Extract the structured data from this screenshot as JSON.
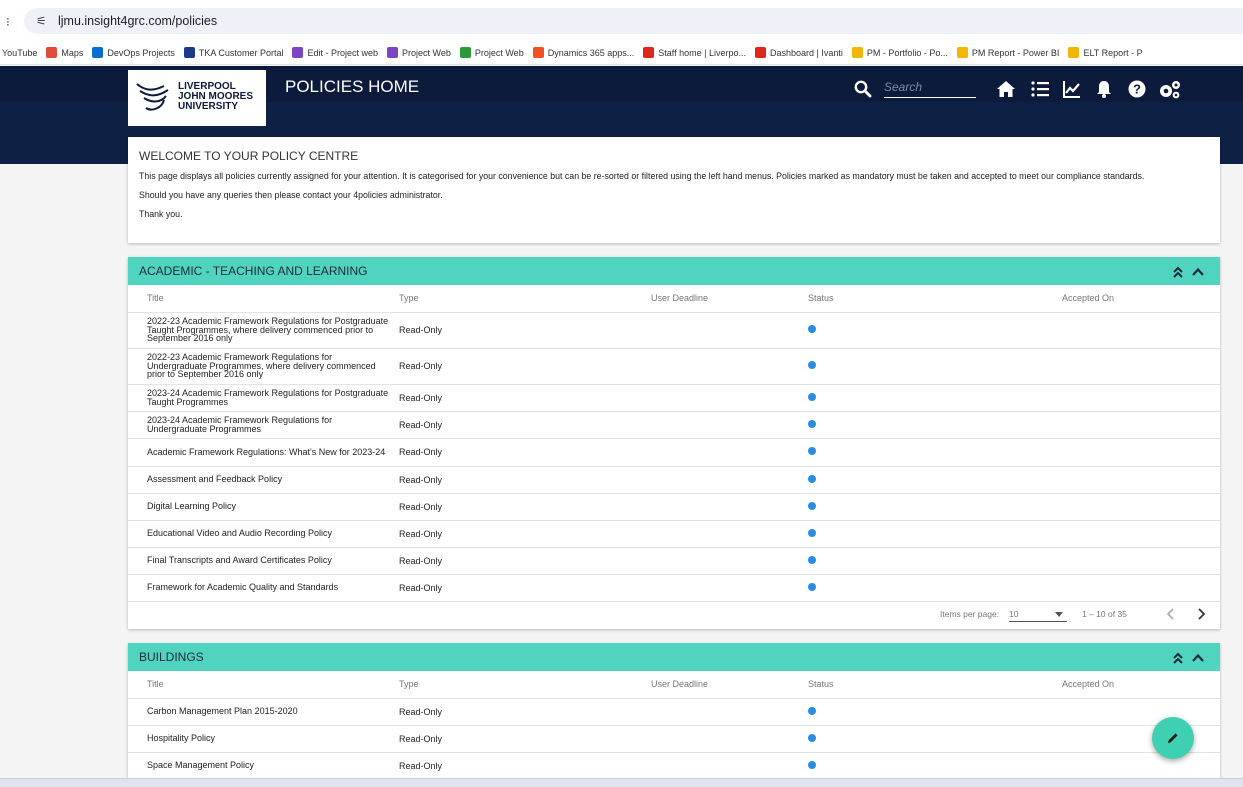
{
  "browser": {
    "url": "ljmu.insight4grc.com/policies",
    "bookmarks": [
      {
        "label": "YouTube",
        "color": ""
      },
      {
        "label": "Maps",
        "color": "#e24a3b"
      },
      {
        "label": "DevOps Projects",
        "color": "#0a6ed1"
      },
      {
        "label": "TKA Customer Portal",
        "color": "#1d3a8a"
      },
      {
        "label": "Edit - Project web",
        "color": "#7b45c4"
      },
      {
        "label": "Project Web",
        "color": "#7b45c4"
      },
      {
        "label": "Project Web",
        "color": "#2b9b3a"
      },
      {
        "label": "Dynamics 365 apps...",
        "color": "#f25022"
      },
      {
        "label": "Staff home | Liverpo...",
        "color": "#e1251b"
      },
      {
        "label": "Dashboard | Ivanti",
        "color": "#e1251b"
      },
      {
        "label": "PM - Portfolio - Po...",
        "color": "#f2b705"
      },
      {
        "label": "PM Report - Power BI",
        "color": "#f2b705"
      },
      {
        "label": "ELT Report - P",
        "color": "#f2b705"
      }
    ]
  },
  "header": {
    "logo_lines": [
      "LIVERPOOL",
      "JOHN MOORES",
      "UNIVERSITY"
    ],
    "title": "POLICIES HOME",
    "search_placeholder": "Search"
  },
  "welcome": {
    "heading": "WELCOME TO YOUR POLICY CENTRE",
    "paragraph1": "This page displays all policies currently assigned for your attention. It is categorised for your convenience but can be re-sorted or filtered using the left hand menus. Policies marked as mandatory must be taken and accepted to meet our compliance standards.",
    "paragraph2": "Should you have any queries then please contact your 4policies administrator.",
    "paragraph3": "Thank you."
  },
  "columns": [
    "Title",
    "Type",
    "User Deadline",
    "Status",
    "Accepted On"
  ],
  "colors": {
    "accent": "#50d4c0",
    "navy": "#0c1a3c",
    "status_dot": "#2b8ce6",
    "fab": "#3fcfb3"
  },
  "sections": [
    {
      "title": "ACADEMIC - TEACHING AND LEARNING",
      "rows": [
        {
          "title": "2022-23 Academic Framework Regulations for Postgraduate Taught Programmes, where delivery commenced prior to September 2016 only",
          "type": "Read-Only",
          "deadline": "",
          "accepted": ""
        },
        {
          "title": "2022-23 Academic Framework Regulations for Undergraduate Programmes, where delivery commenced prior to September 2016 only",
          "type": "Read-Only",
          "deadline": "",
          "accepted": ""
        },
        {
          "title": "2023-24 Academic Framework Regulations for Postgraduate Taught Programmes",
          "type": "Read-Only",
          "deadline": "",
          "accepted": ""
        },
        {
          "title": "2023-24 Academic Framework Regulations for Undergraduate Programmes",
          "type": "Read-Only",
          "deadline": "",
          "accepted": ""
        },
        {
          "title": "Academic Framework Regulations: What's New for 2023-24",
          "type": "Read-Only",
          "deadline": "",
          "accepted": ""
        },
        {
          "title": "Assessment and Feedback Policy",
          "type": "Read-Only",
          "deadline": "",
          "accepted": ""
        },
        {
          "title": "Digital Learning Policy",
          "type": "Read-Only",
          "deadline": "",
          "accepted": ""
        },
        {
          "title": "Educational Video and Audio Recording Policy",
          "type": "Read-Only",
          "deadline": "",
          "accepted": ""
        },
        {
          "title": "Final Transcripts and Award Certificates Policy",
          "type": "Read-Only",
          "deadline": "",
          "accepted": ""
        },
        {
          "title": "Framework for Academic Quality and Standards",
          "type": "Read-Only",
          "deadline": "",
          "accepted": ""
        }
      ],
      "pager": {
        "label": "Items per page:",
        "per_page": "10",
        "range": "1 – 10 of 35"
      }
    },
    {
      "title": "BUILDINGS",
      "rows": [
        {
          "title": "Carbon Management Plan 2015-2020",
          "type": "Read-Only",
          "deadline": "",
          "accepted": ""
        },
        {
          "title": "Hospitality Policy",
          "type": "Read-Only",
          "deadline": "",
          "accepted": ""
        },
        {
          "title": "Space Management Policy",
          "type": "Read-Only",
          "deadline": "",
          "accepted": ""
        }
      ]
    }
  ]
}
